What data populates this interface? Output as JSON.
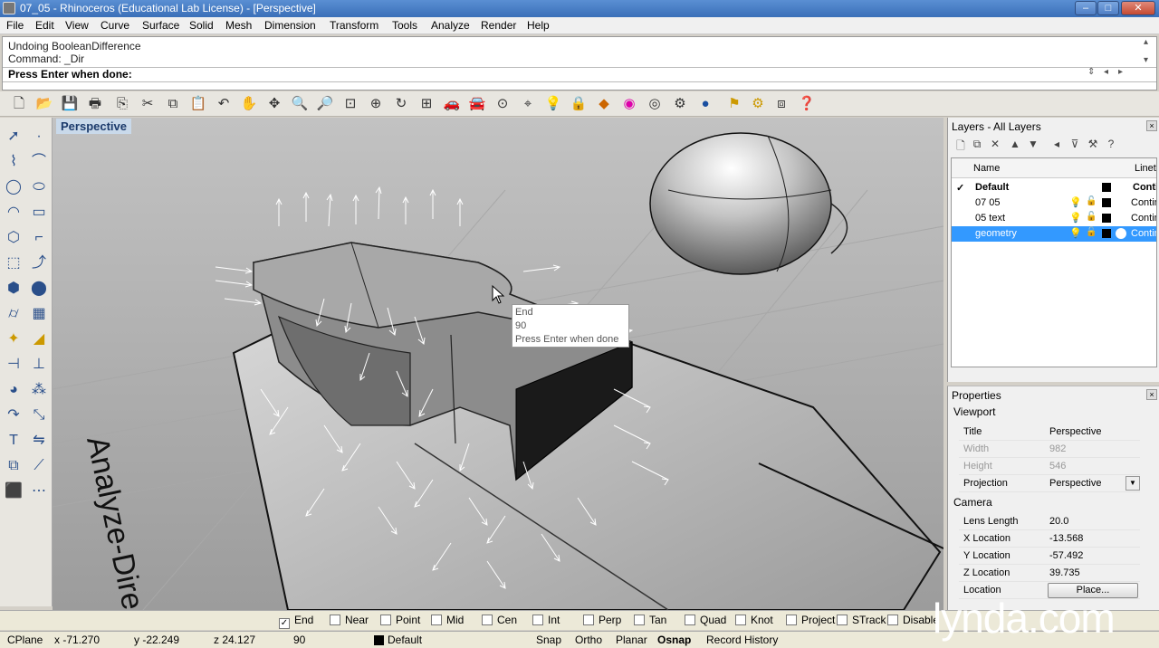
{
  "window": {
    "title": "07_05 - Rhinoceros (Educational Lab License) - [Perspective]",
    "buttons": [
      "–",
      "□",
      "✕"
    ]
  },
  "menu": [
    "File",
    "Edit",
    "View",
    "Curve",
    "Surface",
    "Solid",
    "Mesh",
    "Dimension",
    "Transform",
    "Tools",
    "Analyze",
    "Render",
    "Help"
  ],
  "command": {
    "history": [
      "Undoing BooleanDifference",
      "Command: _Dir"
    ],
    "prompt": "Press Enter when done:"
  },
  "viewport": {
    "label": "Perspective",
    "annotation_text": "Analyze-Dire",
    "tooltip": [
      "End",
      "90",
      "Press Enter when done"
    ]
  },
  "layers": {
    "title": "Layers - All Layers",
    "header": {
      "name": "Name",
      "linetype": "Linety"
    },
    "rows": [
      {
        "name": "Default",
        "linetype": "Conti",
        "current": true,
        "selected": false,
        "color": "#000000"
      },
      {
        "name": "07 05",
        "linetype": "Contin",
        "current": false,
        "selected": false,
        "color": "#000000"
      },
      {
        "name": "05 text",
        "linetype": "Contin",
        "current": false,
        "selected": false,
        "color": "#000000"
      },
      {
        "name": "geometry",
        "linetype": "Contin",
        "current": false,
        "selected": true,
        "color": "#000000"
      }
    ]
  },
  "properties": {
    "title": "Properties",
    "section_viewport": "Viewport",
    "title_label": "Title",
    "title_value": "Perspective",
    "width_label": "Width",
    "width_value": "982",
    "height_label": "Height",
    "height_value": "546",
    "projection_label": "Projection",
    "projection_value": "Perspective",
    "section_camera": "Camera",
    "lens_label": "Lens Length",
    "lens_value": "20.0",
    "xloc_label": "X Location",
    "xloc_value": "-13.568",
    "yloc_label": "Y Location",
    "yloc_value": "-57.492",
    "zloc_label": "Z Location",
    "zloc_value": "39.735",
    "location_label": "Location",
    "place_button": "Place..."
  },
  "osnaps": [
    {
      "label": "End",
      "checked": true
    },
    {
      "label": "Near",
      "checked": false
    },
    {
      "label": "Point",
      "checked": false
    },
    {
      "label": "Mid",
      "checked": false
    },
    {
      "label": "Cen",
      "checked": false
    },
    {
      "label": "Int",
      "checked": false
    },
    {
      "label": "Perp",
      "checked": false
    },
    {
      "label": "Tan",
      "checked": false
    },
    {
      "label": "Quad",
      "checked": false
    },
    {
      "label": "Knot",
      "checked": false
    },
    {
      "label": "Project",
      "checked": false
    },
    {
      "label": "STrack",
      "checked": false
    },
    {
      "label": "Disable",
      "checked": false
    }
  ],
  "status": {
    "cplane": "CPlane",
    "x": "x -71.270",
    "y": "y -22.249",
    "z": "z 24.127",
    "angle": "90",
    "layer": "Default",
    "snap": "Snap",
    "ortho": "Ortho",
    "planar": "Planar",
    "osnap": "Osnap",
    "record_history": "Record History"
  },
  "watermark": "lynda.com"
}
